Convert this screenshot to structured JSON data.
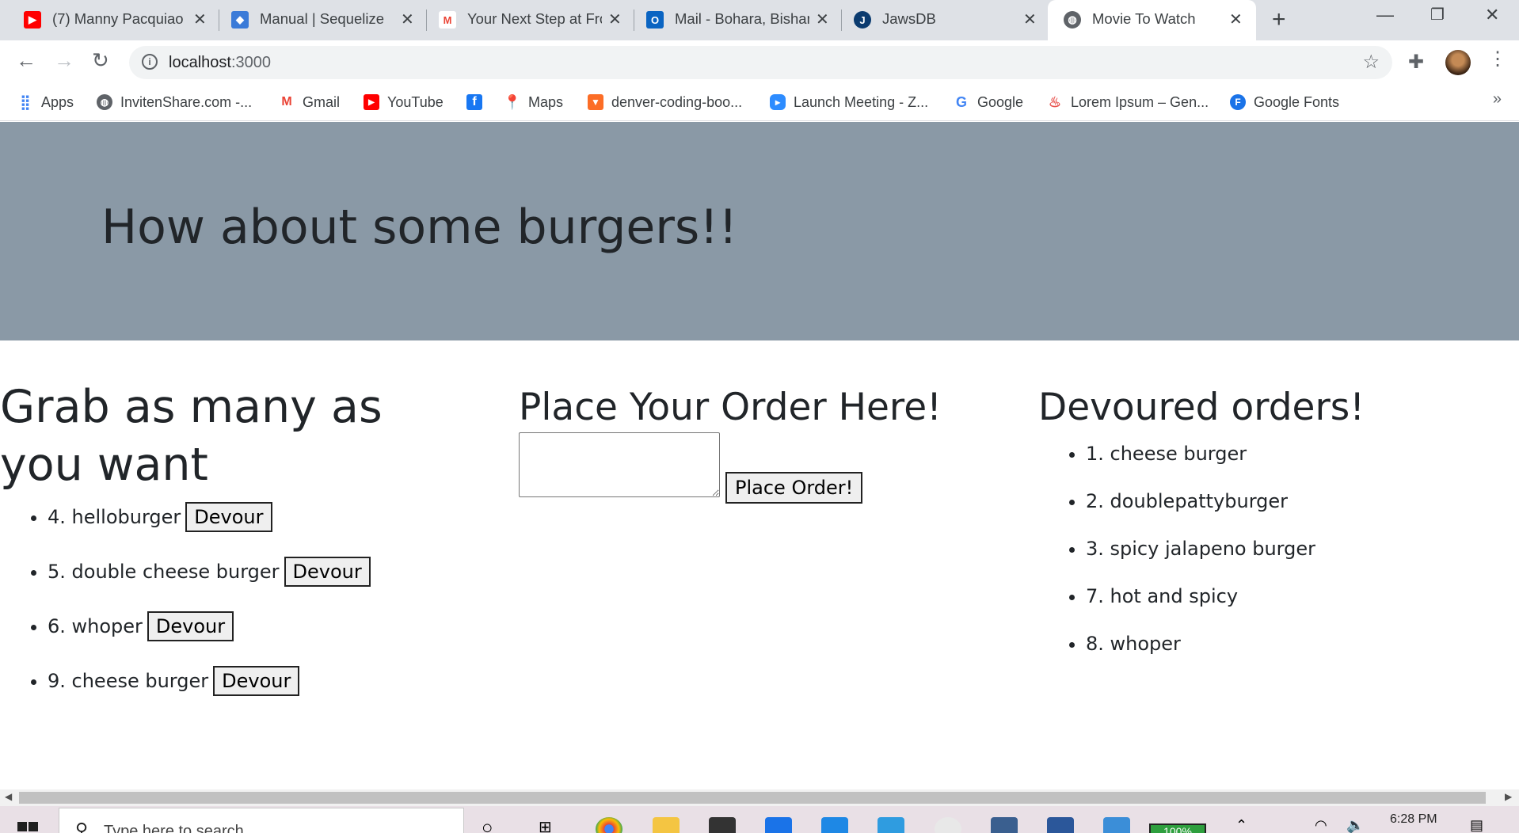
{
  "browser": {
    "tabs": [
      {
        "title": "(7) Manny Pacquiao ",
        "favicon": "youtube-icon",
        "color": "#ff0000"
      },
      {
        "title": "Manual | Sequelize",
        "favicon": "sequelize-icon",
        "color": "#3b7bd8"
      },
      {
        "title": "Your Next Step at Fro",
        "favicon": "gmail-icon",
        "color": "#ea4335"
      },
      {
        "title": "Mail - Bohara, Bishan",
        "favicon": "outlook-icon",
        "color": "#0a64c2"
      },
      {
        "title": "JawsDB",
        "favicon": "jawsdb-icon",
        "color": "#0b3b6f"
      },
      {
        "title": "Movie To Watch",
        "favicon": "globe-icon",
        "color": "#5f6368"
      }
    ],
    "url_host": "localhost",
    "url_port": ":3000"
  },
  "bookmarks": [
    {
      "label": "Apps",
      "icon": "apps-grid-icon",
      "color": "#4285f4"
    },
    {
      "label": "InvitenShare.com -...",
      "icon": "globe-icon",
      "color": "#5f6368"
    },
    {
      "label": "Gmail",
      "icon": "gmail-icon",
      "color": "#ea4335"
    },
    {
      "label": "YouTube",
      "icon": "youtube-icon",
      "color": "#ff0000"
    },
    {
      "label": "",
      "icon": "facebook-icon",
      "color": "#1877f2"
    },
    {
      "label": "Maps",
      "icon": "maps-icon",
      "color": "#34a853"
    },
    {
      "label": "denver-coding-boo...",
      "icon": "gitlab-icon",
      "color": "#fc6d26"
    },
    {
      "label": "Launch Meeting - Z...",
      "icon": "zoom-icon",
      "color": "#2d8cff"
    },
    {
      "label": "Google",
      "icon": "google-icon",
      "color": "#4285f4"
    },
    {
      "label": "Lorem Ipsum – Gen...",
      "icon": "lorem-icon",
      "color": "#e8534f"
    },
    {
      "label": "Google Fonts",
      "icon": "google-fonts-icon",
      "color": "#1a73e8"
    }
  ],
  "page": {
    "banner_title": "How about some burgers!!",
    "available": {
      "heading": "Grab as many as you want",
      "items": [
        {
          "label": "4. helloburger",
          "button": "Devour"
        },
        {
          "label": "5. double cheese burger",
          "button": "Devour"
        },
        {
          "label": "6. whoper",
          "button": "Devour"
        },
        {
          "label": "9. cheese burger",
          "button": "Devour"
        }
      ]
    },
    "order": {
      "heading": "Place Your Order Here!",
      "textarea_value": "",
      "button": "Place Order!"
    },
    "devoured": {
      "heading": "Devoured orders!",
      "items": [
        "1. cheese burger",
        "2. doublepattyburger",
        "3. spicy jalapeno burger",
        "7. hot and spicy",
        "8. whoper"
      ]
    }
  },
  "taskbar": {
    "search_placeholder": "Type here to search",
    "battery": "100%",
    "time": "6:28 PM"
  }
}
